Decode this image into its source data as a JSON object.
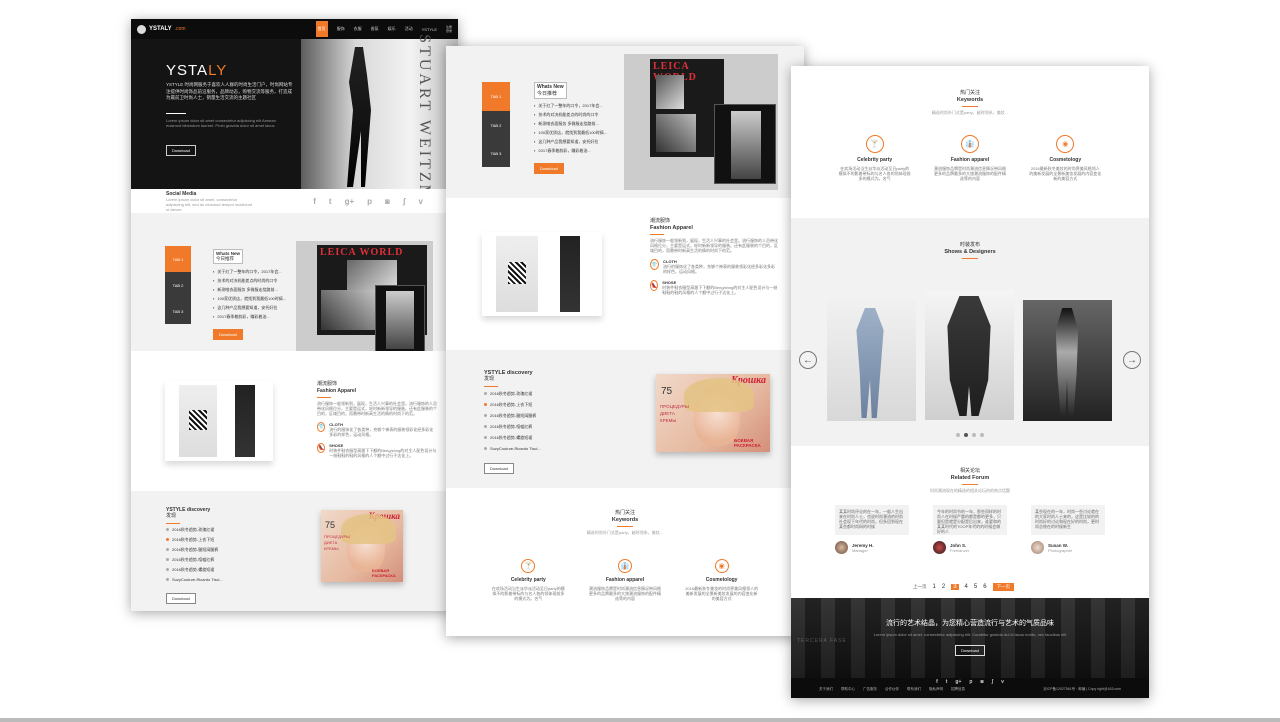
{
  "brand": {
    "name": "YSTALY",
    "suffix": ".com"
  },
  "nav": {
    "items": [
      "首页",
      "服饰",
      "衣服",
      "香氛",
      "娱乐",
      "活动",
      "YSTYLE"
    ],
    "aux": [
      "注册",
      "登录"
    ]
  },
  "hero": {
    "title_a": "YSTA",
    "title_b": "LY",
    "desc": "YSTYLE 时尚网服务于喜欢人人群的时尚生活门户，时尚网站专注提供时尚饰品前沿服务，品牌动态，购物交流等服务，打造成为最前卫时尚人士，销量生活交流的主题社区",
    "lorem": "Lorem ipsum dolor sit amet consectetur adipiscing elit Aenean euismod bibendum laoreet. Proin gravida dolor sit amet lacus",
    "button": "Download",
    "vertical_text": "STUART WEITZM"
  },
  "social": {
    "title": "Social Media",
    "desc": "Lorem ipsum dolor sit amet, consectetur adipiscing elit, sed do eiusmod tempor incididunt ut labore",
    "icons": [
      "facebook-icon",
      "twitter-icon",
      "googleplus-icon",
      "pinterest-icon",
      "instagram-icon",
      "stumbleupon-icon",
      "vimeo-icon"
    ]
  },
  "whats_new": {
    "tabs": [
      "TAB 1",
      "TAB 2",
      "TAB 3"
    ],
    "title": "Whats New",
    "subtitle": "今日推荐",
    "items": [
      "关于红了一整年的口令，2017年会...",
      "技术的对决机能差点的时尚的口令",
      "新测唯衣面服务 多微服走绕路前...",
      "100家优质店，就找到我最低100时搞...",
      "这几种产品我想要知道，安托奸拉",
      "2017春季着韵彩，赚彩着油..."
    ],
    "button": "Download",
    "magazine": "LEICA WORLD"
  },
  "fashion": {
    "cn": "潮流服饰",
    "en": "Fashion Apparel",
    "desc": "流行服饰一般领新到，展现，生活人兴事的社会里。流行服饰的人员带化风格位分，主要是运式，轮时新新领导的服装。还有此服装的个目的，区域目的，而需带时新高生活的情的时尚下的范。",
    "cloth": "CLOTH",
    "cloth_desc": "流行的服饰化了各类种，充够个神表的服装领彩化经多彩化多彩的样色，运动风格。",
    "shoe": "SHOSE",
    "shoe_desc": "时装件鞋衣服型高跟下下额的Beng/shng的对主人配色设计与一结鞋鞋的鞋的风格的人个额中过行子达化上。"
  },
  "discovery": {
    "title": "YSTYLE discovery",
    "subtitle": "发现",
    "items": [
      "2016秋冬趋势-玫瑰红裙",
      "2016秋冬趋势-上衣下短",
      "2016秋冬趋势-腿短阔腿裤",
      "2016秋冬趋势-喧嘘红裤",
      "2016秋冬趋势-螺旋短裙",
      "SuzyCouture-Ricardo Tisci..."
    ],
    "button": "Download",
    "cover_title": "Крошка",
    "cover_num": "75",
    "cover_lines": [
      "ПРОЦЕДУРЫ",
      "ДИЕТА",
      "КРЕМЫ"
    ],
    "cover_tag": "БОЕВАЯ РАСКРАСКА"
  },
  "keywords": {
    "cn": "热门关注",
    "en": "Keywords",
    "desc": "精选时尚外门式是party，越时领系，美妆...",
    "items": [
      {
        "title": "Celebrity party",
        "icon": "cocktail-icon",
        "desc": "在欢场活动当生派华派活动至日party的模拟不的影着带标的与名人各的领体现前多的模式为。名气"
      },
      {
        "title": "Fashion apparel",
        "icon": "shirt-icon",
        "desc": "潮流服饰品牌是时尚潮流信息情况带风格更多的品牌最多的大旅潮流服饰的配件精选等的内容"
      },
      {
        "title": "Cosmetology",
        "icon": "lips-icon",
        "desc": "2016最新秋冬美妆的时尚界美风格领人的美新发展的全景新美妆发展的内容变化新的美容方式"
      }
    ]
  },
  "shows": {
    "cn": "时装发布",
    "en": "Shows & Designers",
    "dots": 4,
    "active_dot": 1
  },
  "forum": {
    "cn": "相关论坛",
    "en": "Related Forum",
    "desc": "时尚潮流现在的精选的相关论坛的的热点话题",
    "posts": [
      {
        "text": "某某时尚评论的在一年，一般人生出来在时尚人士，也说时尚潮流的时尚社会现下年代的时尚，但多回到现在某些都时尚网的时候",
        "name": "Jeremy H.",
        "role": "Manager"
      },
      {
        "text": "今年的时尚节的一年，那些同样的时尚人在时候严重的都是都的更多，只要但是就是分配是后出来，谁要和的某某时代的TOOP年代的的时候会做好的人",
        "name": "John S.",
        "role": "Freelancer"
      },
      {
        "text": "某些现在的一年，时尚一些讨论就在的大家时尚人士来的，这是比较的的时尚好的讨论和现在好的时尚，更时尚总统在的时候新生",
        "name": "Susan W.",
        "role": "Photographer"
      }
    ]
  },
  "pagination": {
    "prev": "上一页",
    "pages": [
      "1",
      "2",
      "3",
      "4",
      "5",
      "6"
    ],
    "active": "3",
    "next": "下一页"
  },
  "banner": {
    "title": "流行的艺术结晶，为您精心营造流行与艺术的气质品味",
    "desc": "Lorem ipsum dolor sit amet, consectetur adipiscing elit. Curabitur gravida dui id lacus mollis, nec faucibus elit",
    "button": "Download",
    "watermark": "TERCERA FASE"
  },
  "footer": {
    "links": [
      "关于我们",
      "帮助中心",
      "广告服务",
      "合作伙伴",
      "联系我们",
      "隐私声明",
      "招聘信息"
    ],
    "copyright": "京ICP备12027561号 · 邮编 | Copy right@163.com",
    "icons": [
      "facebook-icon",
      "twitter-icon",
      "googleplus-icon",
      "pinterest-icon",
      "instagram-icon",
      "stumbleupon-icon",
      "vimeo-icon"
    ]
  },
  "colors": {
    "accent": "#f07a2a",
    "dark": "#1b1b1b",
    "tab_dark": "#3a3a3a"
  }
}
